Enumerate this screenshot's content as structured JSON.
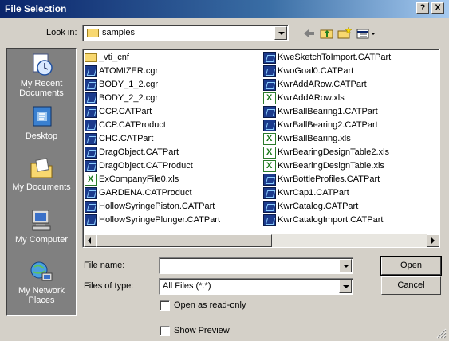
{
  "window": {
    "title": "File Selection",
    "help_glyph": "?",
    "close_glyph": "X"
  },
  "lookin": {
    "label": "Look in:",
    "value": "samples"
  },
  "toolbar": {
    "icons": [
      "back-icon",
      "up-folder-icon",
      "new-folder-icon",
      "view-menu-icon"
    ]
  },
  "places": [
    {
      "label": "My Recent Documents",
      "icon": "recent-documents-icon"
    },
    {
      "label": "Desktop",
      "icon": "desktop-icon"
    },
    {
      "label": "My Documents",
      "icon": "my-documents-icon"
    },
    {
      "label": "My Computer",
      "icon": "my-computer-icon"
    },
    {
      "label": "My Network Places",
      "icon": "network-places-icon"
    }
  ],
  "files": {
    "col1": [
      {
        "name": "_vti_cnf",
        "type": "folder"
      },
      {
        "name": "ATOMIZER.cgr",
        "type": "cat"
      },
      {
        "name": "BODY_1_2.cgr",
        "type": "cat"
      },
      {
        "name": "BODY_2_2.cgr",
        "type": "cat"
      },
      {
        "name": "CCP.CATPart",
        "type": "cat"
      },
      {
        "name": "CCP.CATProduct",
        "type": "cat"
      },
      {
        "name": "CHC.CATPart",
        "type": "cat"
      },
      {
        "name": "DragObject.CATPart",
        "type": "cat"
      },
      {
        "name": "DragObject.CATProduct",
        "type": "cat"
      },
      {
        "name": "ExCompanyFile0.xls",
        "type": "xls"
      },
      {
        "name": "GARDENA.CATProduct",
        "type": "cat"
      },
      {
        "name": "HollowSyringePiston.CATPart",
        "type": "cat"
      },
      {
        "name": "HollowSyringePlunger.CATPart",
        "type": "cat"
      }
    ],
    "col2": [
      {
        "name": "KweSketchToImport.CATPart",
        "type": "cat"
      },
      {
        "name": "KwoGoal0.CATPart",
        "type": "cat"
      },
      {
        "name": "KwrAddARow.CATPart",
        "type": "cat"
      },
      {
        "name": "KwrAddARow.xls",
        "type": "xls"
      },
      {
        "name": "KwrBallBearing1.CATPart",
        "type": "cat"
      },
      {
        "name": "KwrBallBearing2.CATPart",
        "type": "cat"
      },
      {
        "name": "KwrBallBearing.xls",
        "type": "xls"
      },
      {
        "name": "KwrBearingDesignTable2.xls",
        "type": "xls"
      },
      {
        "name": "KwrBearingDesignTable.xls",
        "type": "xls"
      },
      {
        "name": "KwrBottleProfiles.CATPart",
        "type": "cat"
      },
      {
        "name": "KwrCap1.CATPart",
        "type": "cat"
      },
      {
        "name": "KwrCatalog.CATPart",
        "type": "cat"
      },
      {
        "name": "KwrCatalogImport.CATPart",
        "type": "cat"
      }
    ]
  },
  "form": {
    "filename_label": "File name:",
    "filename_value": "",
    "filetype_label": "Files of type:",
    "filetype_value": "All Files (*.*)",
    "readonly_label": "Open as read-only",
    "preview_label": "Show Preview",
    "open_label": "Open",
    "cancel_label": "Cancel"
  }
}
